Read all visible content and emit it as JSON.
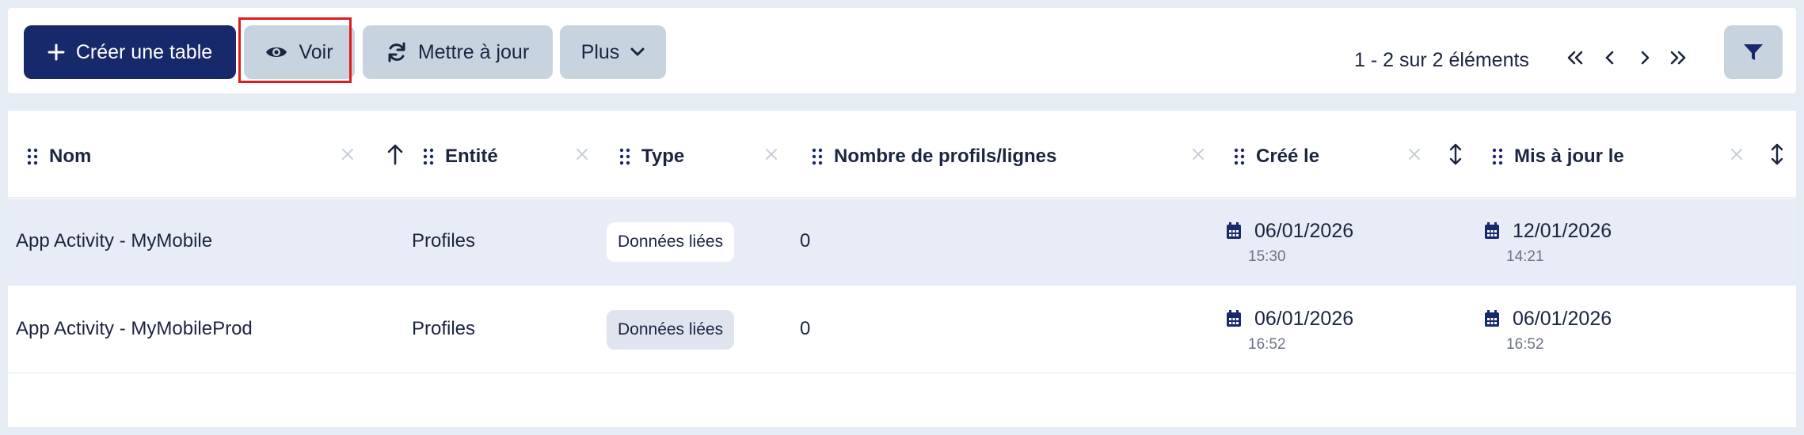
{
  "toolbar": {
    "create_label": "Créer une table",
    "view_label": "Voir",
    "refresh_label": "Mettre à jour",
    "more_label": "Plus",
    "pagination_info": "1 - 2 sur 2 éléments"
  },
  "table": {
    "columns": [
      {
        "label": "Nom"
      },
      {
        "label": "Entité"
      },
      {
        "label": "Type"
      },
      {
        "label": "Nombre de profils/lignes"
      },
      {
        "label": "Créé le"
      },
      {
        "label": "Mis à jour le"
      }
    ],
    "rows": [
      {
        "name": "App Activity - MyMobile",
        "entity": "Profiles",
        "type": "Données liées",
        "count": "0",
        "created_date": "06/01/2026",
        "created_time": "15:30",
        "updated_date": "12/01/2026",
        "updated_time": "14:21"
      },
      {
        "name": "App Activity - MyMobileProd",
        "entity": "Profiles",
        "type": "Données liées",
        "count": "0",
        "created_date": "06/01/2026",
        "created_time": "16:52",
        "updated_date": "06/01/2026",
        "updated_time": "16:52"
      }
    ]
  },
  "colors": {
    "primary": "#17296b",
    "secondary_button": "#c8d3e0",
    "selected_row": "#e8ecf6",
    "highlight": "#e01b1b"
  }
}
